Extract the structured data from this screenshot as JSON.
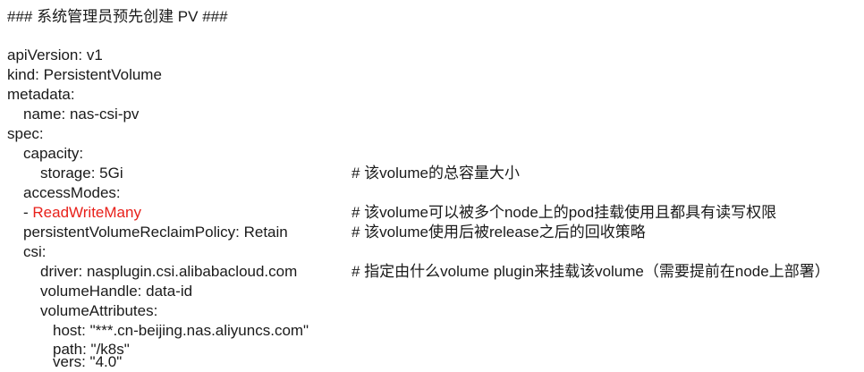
{
  "header": "### 系统管理员预先创建 PV ###",
  "lines": {
    "api_version": "apiVersion: v1",
    "kind": "kind: PersistentVolume",
    "metadata": "metadata:",
    "name": "name: nas-csi-pv",
    "spec": "spec:",
    "capacity": "capacity:",
    "storage": "storage: 5Gi",
    "storage_comment": "# 该volume的总容量大小",
    "access_modes": "accessModes:",
    "access_mode_dash": "- ",
    "access_mode_value": "ReadWriteMany",
    "access_mode_comment": "# 该volume可以被多个node上的pod挂载使用且都具有读写权限",
    "reclaim_policy": "persistentVolumeReclaimPolicy: Retain",
    "reclaim_comment": "# 该volume使用后被release之后的回收策略",
    "csi": "csi:",
    "driver": "driver: nasplugin.csi.alibabacloud.com",
    "driver_comment": "# 指定由什么volume plugin来挂载该volume（需要提前在node上部署）",
    "volume_handle": "volumeHandle: data-id",
    "volume_attributes": "volumeAttributes:",
    "host": "host: \"***.cn-beijing.nas.aliyuncs.com\"",
    "path": "path: \"/k8s\"",
    "vers": "vers: \"4.0\""
  },
  "colors": {
    "text": "#1a1a1a",
    "highlight": "#e8211b",
    "background": "#ffffff"
  }
}
